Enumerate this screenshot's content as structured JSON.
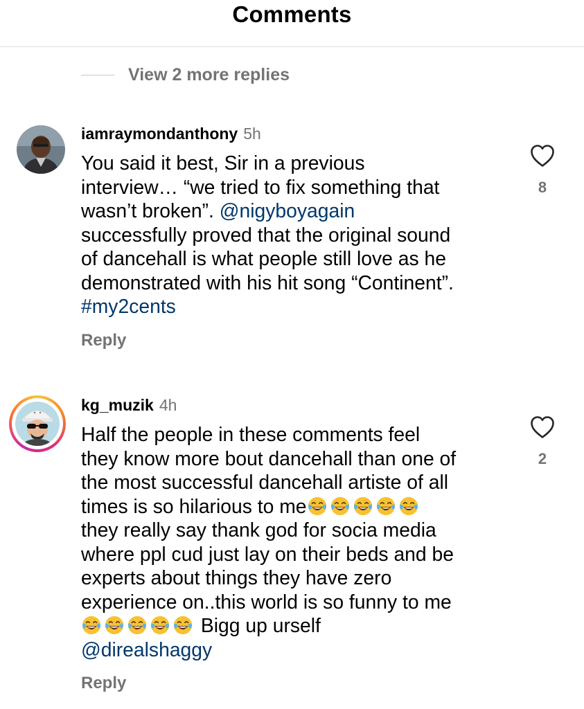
{
  "header": {
    "title": "Comments"
  },
  "thread": {
    "view_more_replies": "View 2 more replies"
  },
  "comments": [
    {
      "username": "iamraymondanthony",
      "time": "5h",
      "lines": [
        "You said it best, Sir in a previous",
        "interview… “we tried to fix something that",
        "wasn’t broken”.",
        "@nigyboyagain",
        "successfully proved that the original sound",
        "of dancehall is what people still love as he",
        "demonstrated with his hit song “Continent”.",
        "#my2cents"
      ],
      "reply_label": "Reply",
      "like_count": "8",
      "avatar_ring": false
    },
    {
      "username": "kg_muzik",
      "time": "4h",
      "lines": [
        "Half the people in these comments feel",
        "they know more bout dancehall than one of",
        "the most successful dancehall artiste of all",
        "times is so hilarious to me",
        "they really say thank god for socia media",
        "where ppl cud just lay on their beds and be",
        "experts about things they have zero",
        "experience on..this world is so funny to me",
        "Bigg up urself",
        "@direalshaggy"
      ],
      "emoji": "face-with-tears-of-joy",
      "reply_label": "Reply",
      "like_count": "2",
      "avatar_ring": true
    }
  ],
  "colors": {
    "secondary_text": "#737373",
    "link": "#00376b",
    "divider": "#dbdbdb"
  },
  "icons": {
    "like": "heart-outline-icon",
    "avatar": "avatar"
  }
}
